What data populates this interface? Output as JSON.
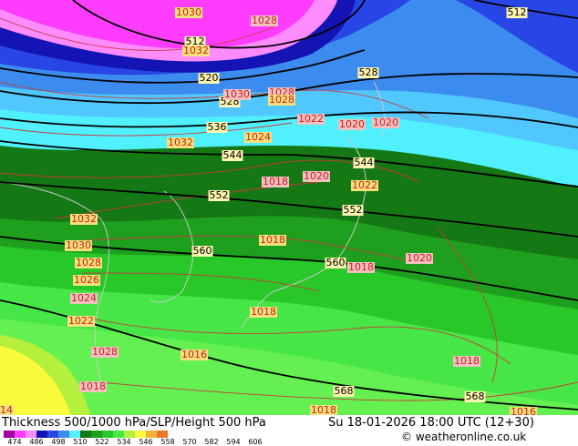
{
  "map": {
    "thickness_labels": [
      "512",
      "512",
      "520",
      "528",
      "528",
      "536",
      "544",
      "544",
      "552",
      "552",
      "560",
      "560",
      "568",
      "568"
    ],
    "slp_labels": [
      "1030",
      "1028",
      "1032",
      "1030",
      "1028",
      "1028",
      "1022",
      "1020",
      "1020",
      "1024",
      "1032",
      "1018",
      "1020",
      "1022",
      "1032",
      "1018",
      "1030",
      "1028",
      "1020",
      "1026",
      "1018",
      "1024",
      "1018",
      "1022",
      "1028",
      "1016",
      "1018",
      "1018",
      "1018",
      "1016",
      "14"
    ],
    "colors": {
      "magenta": "#ff3cff",
      "pink": "#ff8cff",
      "navy": "#1414b4",
      "blue": "#2846e6",
      "mid_blue": "#3c8cf0",
      "light_blue": "#50c8ff",
      "cyan": "#50f0ff",
      "dark_green": "#147814",
      "green": "#1ea01e",
      "mid_green": "#28c828",
      "bright_green": "#46e646",
      "light_green": "#64f050",
      "yellow_green": "#b4f03c",
      "yellow": "#fafa3c",
      "slp_contour": "#c83c3c",
      "thickness_contour": "#000000",
      "coastline": "#c8c8c8"
    }
  },
  "footer": {
    "title": "Thickness 500/1000 hPa/SLP/Height 500 hPa",
    "datetime": "Su 18-01-2026 18:00 UTC (12+30)",
    "copyright": "© weatheronline.co.uk",
    "scale_colors": [
      "#a000a0",
      "#ff3cff",
      "#ff8cff",
      "#1414b4",
      "#2846e6",
      "#3c8cf0",
      "#50f0ff",
      "#147814",
      "#1ea01e",
      "#28c828",
      "#46e646",
      "#b4f03c",
      "#fafa3c",
      "#f0b43c",
      "#e67828"
    ],
    "scale_ticks": [
      "474",
      "486",
      "498",
      "510",
      "522",
      "534",
      "546",
      "558",
      "570",
      "582",
      "594",
      "606"
    ]
  }
}
